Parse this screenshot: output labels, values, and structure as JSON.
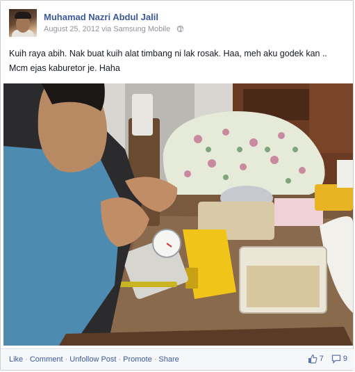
{
  "post": {
    "author": "Muhamad Nazri Abdul Jalil",
    "date": "August 25, 2012",
    "via": "via Samsung Mobile",
    "text": "Kuih raya abih. Nak buat kuih alat timbang ni lak rosak. Haa, meh aku godek kan .. Mcm ejas kaburetor je. Haha"
  },
  "footer": {
    "like": "Like",
    "comment": "Comment",
    "unfollow": "Unfollow Post",
    "promote": "Promote",
    "share": "Share",
    "separator": "·",
    "likes_count": "7",
    "comments_count": "9"
  },
  "icons": {
    "privacy": "globe-icon",
    "likes": "thumbs-up-icon",
    "comments": "comment-bubble-icon"
  },
  "colors": {
    "link": "#3b5998",
    "meta": "#90949c",
    "text": "#141823"
  }
}
